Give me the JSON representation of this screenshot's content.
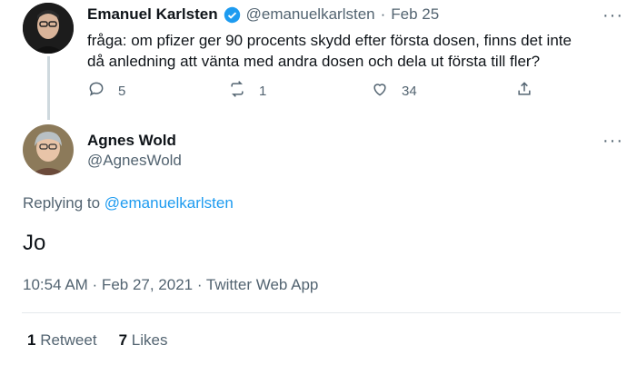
{
  "parent_tweet": {
    "author_name": "Emanuel Karlsten",
    "handle": "@emanuelkarlsten",
    "separator": "·",
    "date": "Feb 25",
    "text_line1": "fråga: om pfizer ger 90 procents skydd efter första dosen, finns det inte",
    "text_line2": "då anledning att vänta med andra dosen och dela ut första till fler?",
    "replies": "5",
    "retweets": "1",
    "likes": "34",
    "more": "···"
  },
  "main_tweet": {
    "author_name": "Agnes Wold",
    "handle": "@AgnesWold",
    "more": "···",
    "replying_prefix": "Replying to",
    "replying_to": "@emanuelkarlsten",
    "text": "Jo",
    "timestamp": "10:54 AM · Feb 27, 2021 · Twitter Web App",
    "retweet_count": "1",
    "retweet_label": "Retweet",
    "like_count": "7",
    "like_label": "Likes"
  },
  "colors": {
    "accent": "#1d9bf0",
    "verified": "#1d9bf0",
    "muted": "#536471"
  }
}
